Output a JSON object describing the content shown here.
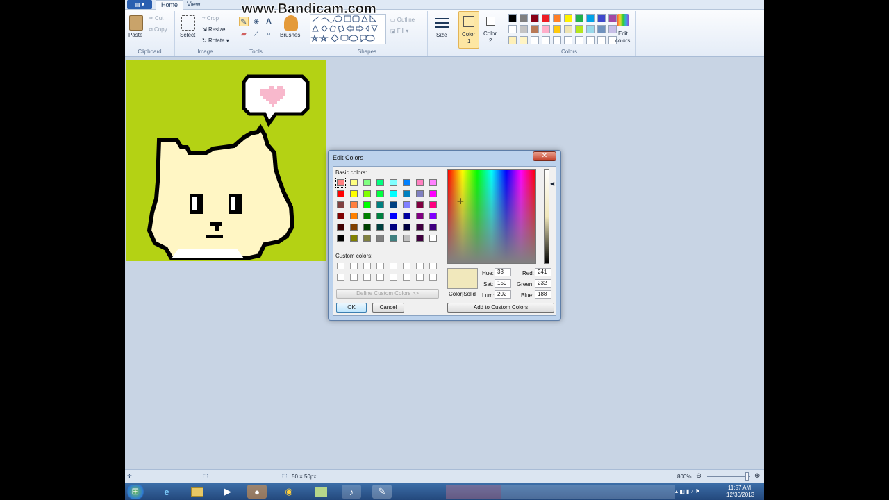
{
  "watermark": "www.Bandicam.com",
  "tabs": [
    {
      "label": "Home"
    },
    {
      "label": "View"
    }
  ],
  "ribbon": {
    "clipboard": {
      "paste": "Paste",
      "cut": "Cut",
      "copy": "Copy",
      "label": "Clipboard"
    },
    "image": {
      "select": "Select",
      "crop": "Crop",
      "resize": "Resize",
      "rotate": "Rotate",
      "label": "Image"
    },
    "tools": {
      "label": "Tools"
    },
    "brushes": {
      "label": "Brushes"
    },
    "shapes": {
      "outline": "Outline",
      "fill": "Fill",
      "label": "Shapes"
    },
    "size": {
      "label": "Size"
    },
    "color1": {
      "label": "Color",
      "index": "1"
    },
    "color2": {
      "label": "Color",
      "index": "2"
    },
    "colors": {
      "label": "Colors"
    },
    "edit_colors": {
      "line1": "Edit",
      "line2": "colors"
    }
  },
  "palette": {
    "row1": [
      "#000000",
      "#7f7f7f",
      "#880015",
      "#ed1c24",
      "#ff7f27",
      "#fff200",
      "#22b14c",
      "#00a2e8",
      "#3f48cc",
      "#a349a4"
    ],
    "row2": [
      "#ffffff",
      "#c3c3c3",
      "#b97a57",
      "#ffaec9",
      "#ffc90e",
      "#efe4b0",
      "#b5e61d",
      "#99d9ea",
      "#7092be",
      "#c8bfe7"
    ],
    "row3": [
      "#fef0b8",
      "#fff4c4",
      "#ffffff",
      "#ffffff",
      "#ffffff",
      "#ffffff",
      "#ffffff",
      "#ffffff",
      "#ffffff",
      "#ffffff"
    ],
    "color1": "#fde9ac",
    "color2": "#ffffff"
  },
  "canvas": {
    "background": "#b4d214",
    "cat_fill": "#fff6c4",
    "heart": "#f8b8cc"
  },
  "dialog": {
    "title": "Edit Colors",
    "close": "✕",
    "basic_label": "Basic colors:",
    "custom_label": "Custom colors:",
    "define_btn": "Define Custom Colors >>",
    "ok": "OK",
    "cancel": "Cancel",
    "add_btn": "Add to Custom Colors",
    "color_solid": "Color|Solid",
    "preview": "#f1e8bc",
    "hue_label": "Hue:",
    "hue": "33",
    "sat_label": "Sat:",
    "sat": "159",
    "lum_label": "Lum:",
    "lum": "202",
    "red_label": "Red:",
    "red": "241",
    "green_label": "Green:",
    "green": "232",
    "blue_label": "Blue:",
    "blue": "188",
    "basic_colors": [
      "#ff8080",
      "#ffff80",
      "#80ff80",
      "#00ff80",
      "#80ffff",
      "#0080ff",
      "#ff80c0",
      "#ff80ff",
      "#ff0000",
      "#ffff00",
      "#80ff00",
      "#00ff40",
      "#00ffff",
      "#0080c0",
      "#8080c0",
      "#ff00ff",
      "#804040",
      "#ff8040",
      "#00ff00",
      "#008080",
      "#004080",
      "#8080ff",
      "#800040",
      "#ff0080",
      "#800000",
      "#ff8000",
      "#008000",
      "#008040",
      "#0000ff",
      "#0000a0",
      "#800080",
      "#8000ff",
      "#400000",
      "#804000",
      "#004000",
      "#004040",
      "#000080",
      "#000040",
      "#400040",
      "#400080",
      "#000000",
      "#808000",
      "#808040",
      "#808080",
      "#408080",
      "#c0c0c0",
      "#400040",
      "#ffffff"
    ]
  },
  "status": {
    "size": "50 × 50px",
    "zoom": "800%"
  },
  "taskbar": {
    "time": "11:57 AM",
    "date": "12/30/2013"
  }
}
